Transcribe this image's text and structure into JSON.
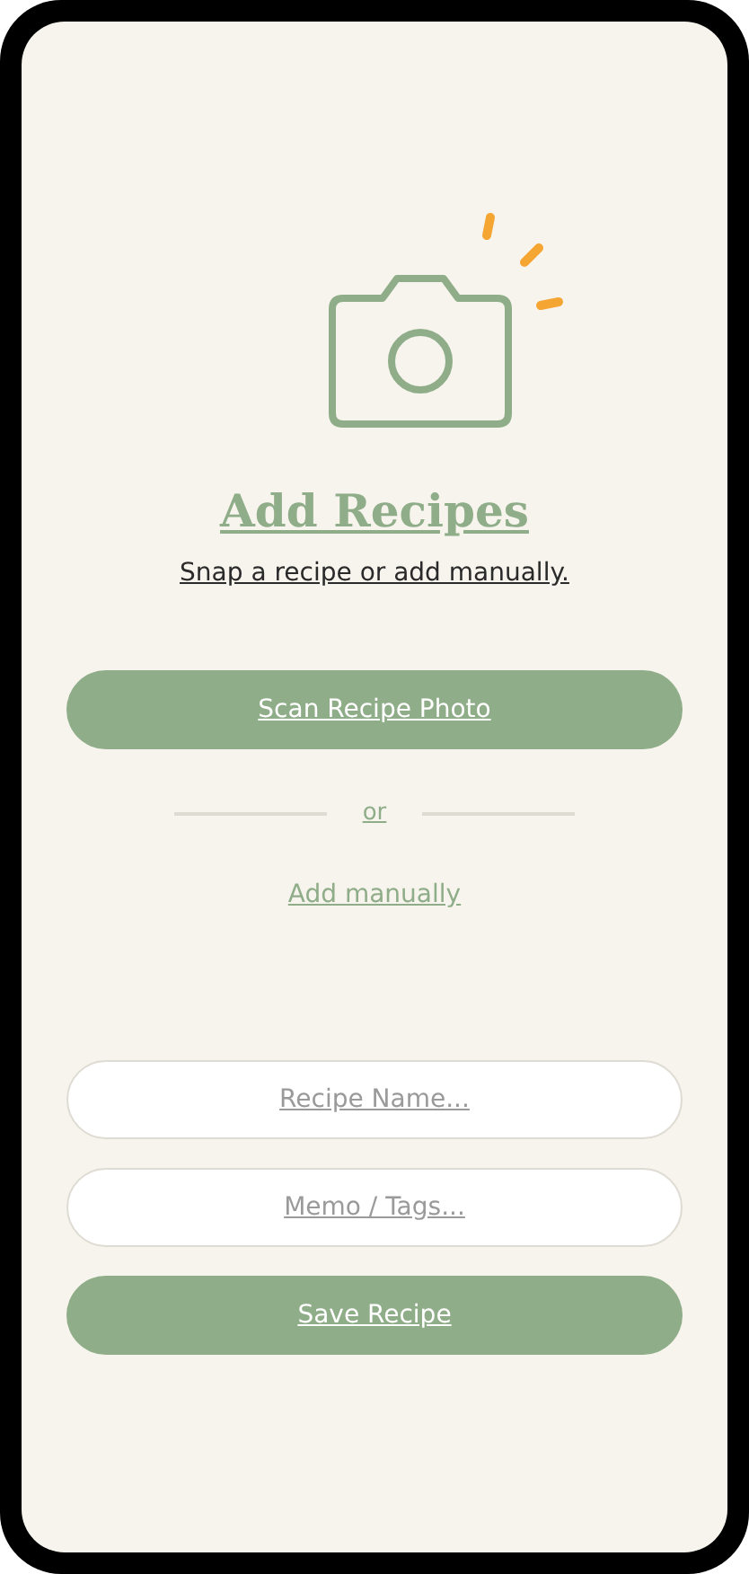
{
  "title": "Add Recipes",
  "subtitle": "Snap a recipe or add manually.",
  "scan_button": "Scan Recipe Photo",
  "divider_text": "or",
  "manual_link": "Add manually",
  "fields": [
    {
      "placeholder": "Recipe Name..."
    },
    {
      "placeholder": "Memo / Tags..."
    }
  ],
  "save_button": "Save Recipe"
}
